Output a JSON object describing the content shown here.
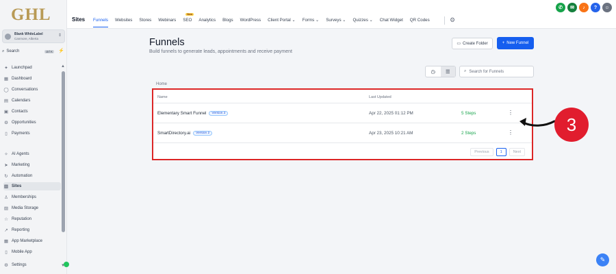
{
  "logo": "GHL",
  "account": {
    "name": "Blank WhiteLabel",
    "location": "Canmore, Alberta"
  },
  "search": {
    "label": "Search",
    "shortcut": "ctrl K"
  },
  "sidebar": {
    "items": [
      {
        "label": "Launchpad",
        "icon": "rocket-icon"
      },
      {
        "label": "Dashboard",
        "icon": "dashboard-icon"
      },
      {
        "label": "Conversations",
        "icon": "chat-icon"
      },
      {
        "label": "Calendars",
        "icon": "calendar-icon"
      },
      {
        "label": "Contacts",
        "icon": "contacts-icon"
      },
      {
        "label": "Opportunities",
        "icon": "opportunities-icon"
      },
      {
        "label": "Payments",
        "icon": "payments-icon"
      },
      {
        "label": "AI Agents",
        "icon": "ai-icon"
      },
      {
        "label": "Marketing",
        "icon": "marketing-icon"
      },
      {
        "label": "Automation",
        "icon": "automation-icon"
      },
      {
        "label": "Sites",
        "icon": "sites-icon"
      },
      {
        "label": "Memberships",
        "icon": "memberships-icon"
      },
      {
        "label": "Media Storage",
        "icon": "media-icon"
      },
      {
        "label": "Reputation",
        "icon": "star-icon"
      },
      {
        "label": "Reporting",
        "icon": "reporting-icon"
      },
      {
        "label": "App Marketplace",
        "icon": "marketplace-icon"
      },
      {
        "label": "Mobile App",
        "icon": "mobile-icon"
      },
      {
        "label": "Settings",
        "icon": "gear-icon"
      }
    ]
  },
  "header": {
    "section": "Sites",
    "tabs": [
      "Funnels",
      "Websites",
      "Stores",
      "Webinars",
      "SEO",
      "Analytics",
      "Blogs",
      "WordPress",
      "Client Portal",
      "Forms",
      "Surveys",
      "Quizzes",
      "Chat Widget",
      "QR Codes"
    ],
    "new_badge": "New"
  },
  "main": {
    "title": "Funnels",
    "subtitle": "Build funnels to generate leads, appointments and receive payment",
    "create_folder": "Create Folder",
    "new_funnel": "New Funnel",
    "search_placeholder": "Search for Funnels",
    "breadcrumb": "Home",
    "columns": [
      "Name",
      "Last Updated"
    ],
    "rows": [
      {
        "name": "Elementary Smart Funnel",
        "version": "Version 2",
        "updated": "Apr 22, 2025 01:12 PM",
        "steps": "5 Steps"
      },
      {
        "name": "SmartDirectory.ai",
        "version": "Version 2",
        "updated": "Apr 23, 2025 10:21 AM",
        "steps": "2 Steps"
      }
    ],
    "pager": {
      "prev": "Previous",
      "page": "1",
      "next": "Next"
    }
  },
  "annotation": {
    "number": "3",
    "color": "#e11d2e"
  },
  "colors": {
    "accent": "#155eef",
    "highlight_border": "#dc2626",
    "steps": "#16a34a"
  }
}
